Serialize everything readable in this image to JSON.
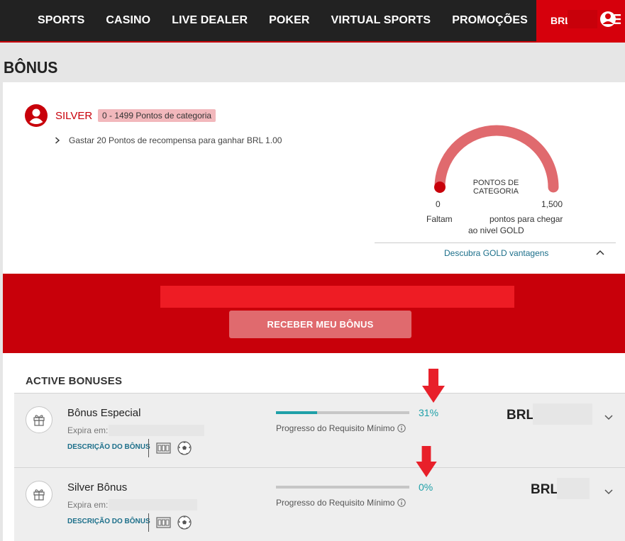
{
  "nav": {
    "items": [
      "SPORTS",
      "CASINO",
      "LIVE DEALER",
      "POKER",
      "VIRTUAL SPORTS",
      "PROMOÇÕES"
    ]
  },
  "account": {
    "currency": "BRL",
    "icon": "user-menu-icon"
  },
  "page": {
    "title": "BÔNUS"
  },
  "tier": {
    "name": "SILVER",
    "range": "0 - 1499 Pontos de categoria",
    "reward_info": "Gastar 20 Pontos de recompensa para ganhar BRL 1.00"
  },
  "gauge": {
    "label": "PONTOS DE CATEGORIA",
    "min": "0",
    "max": "1,500",
    "value_fraction": 0,
    "remaining_text_left": "Faltam",
    "remaining_text_right": "pontos para chegar",
    "remaining_text_line2": "ao nivel GOLD",
    "discover_link": "Descubra GOLD vantagens"
  },
  "claim": {
    "button_label": "RECEBER MEU BÔNUS"
  },
  "active_bonuses": {
    "title": "ACTIVE BONUSES",
    "items": [
      {
        "name": "Bônus Especial",
        "expires_label": "Expira em:",
        "description_link": "DESCRIÇÃO DO BÔNUS",
        "progress_pct": 31,
        "progress_text": "31%",
        "requirement_label": "Progresso do Requisito Mínimo",
        "currency": "BRL"
      },
      {
        "name": "Silver Bônus",
        "expires_label": "Expira em:",
        "description_link": "DESCRIÇÃO DO BÔNUS",
        "progress_pct": 0,
        "progress_text": "0%",
        "requirement_label": "Progresso do Requisito Mínimo",
        "currency": "BRL"
      }
    ]
  },
  "colors": {
    "brand_red": "#c8000a",
    "nav_bg": "#222222",
    "gauge_arc": "#e06a6e",
    "progress_teal": "#1fa0a8",
    "link_blue": "#1c6f8a",
    "annotation_arrow": "#e8202a"
  }
}
